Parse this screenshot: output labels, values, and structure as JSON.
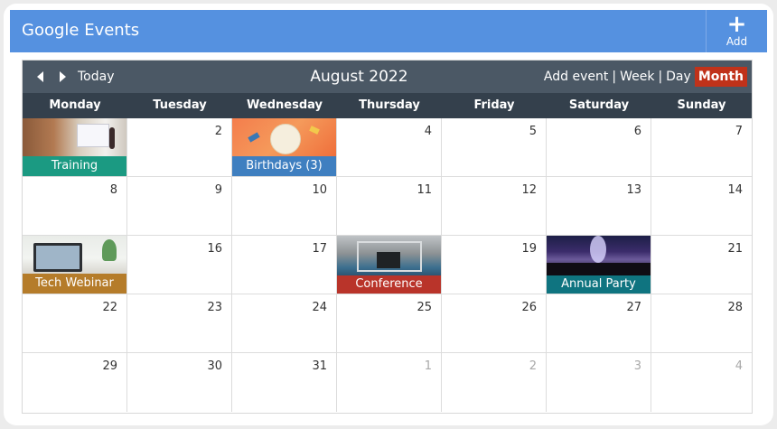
{
  "app": {
    "title": "Google Events",
    "add_label": "Add",
    "add_icon": "plus-icon"
  },
  "nav": {
    "today": "Today",
    "month_title": "August 2022",
    "views": {
      "add_event": "Add event",
      "week": "Week",
      "day": "Day",
      "month": "Month",
      "active": "Month"
    },
    "separator": "|",
    "prev_icon": "triangle-left-icon",
    "next_icon": "triangle-right-icon"
  },
  "days": [
    "Monday",
    "Tuesday",
    "Wednesday",
    "Thursday",
    "Friday",
    "Saturday",
    "Sunday"
  ],
  "weeks": [
    [
      "",
      "2",
      "",
      "4",
      "5",
      "6",
      "7"
    ],
    [
      "8",
      "9",
      "10",
      "11",
      "12",
      "13",
      "14"
    ],
    [
      "",
      "16",
      "17",
      "",
      "19",
      "",
      "21"
    ],
    [
      "22",
      "23",
      "24",
      "25",
      "26",
      "27",
      "28"
    ],
    [
      "29",
      "30",
      "31",
      "1",
      "2",
      "3",
      "4"
    ]
  ],
  "events": {
    "training": {
      "label": "Training",
      "color": "#1b9a82"
    },
    "birthdays": {
      "label": "Birthdays (3)",
      "color": "#3f7fc0"
    },
    "tech_webinar": {
      "label": "Tech Webinar",
      "color": "#b57c2a"
    },
    "conference": {
      "label": "Conference",
      "color": "#b9342a"
    },
    "annual_party": {
      "label": "Annual Party",
      "color": "#0f7480"
    }
  },
  "colors": {
    "topbar": "#5591e0",
    "nav": "#4b5865",
    "dayhead": "#34404c",
    "active_view": "#c0321a"
  }
}
